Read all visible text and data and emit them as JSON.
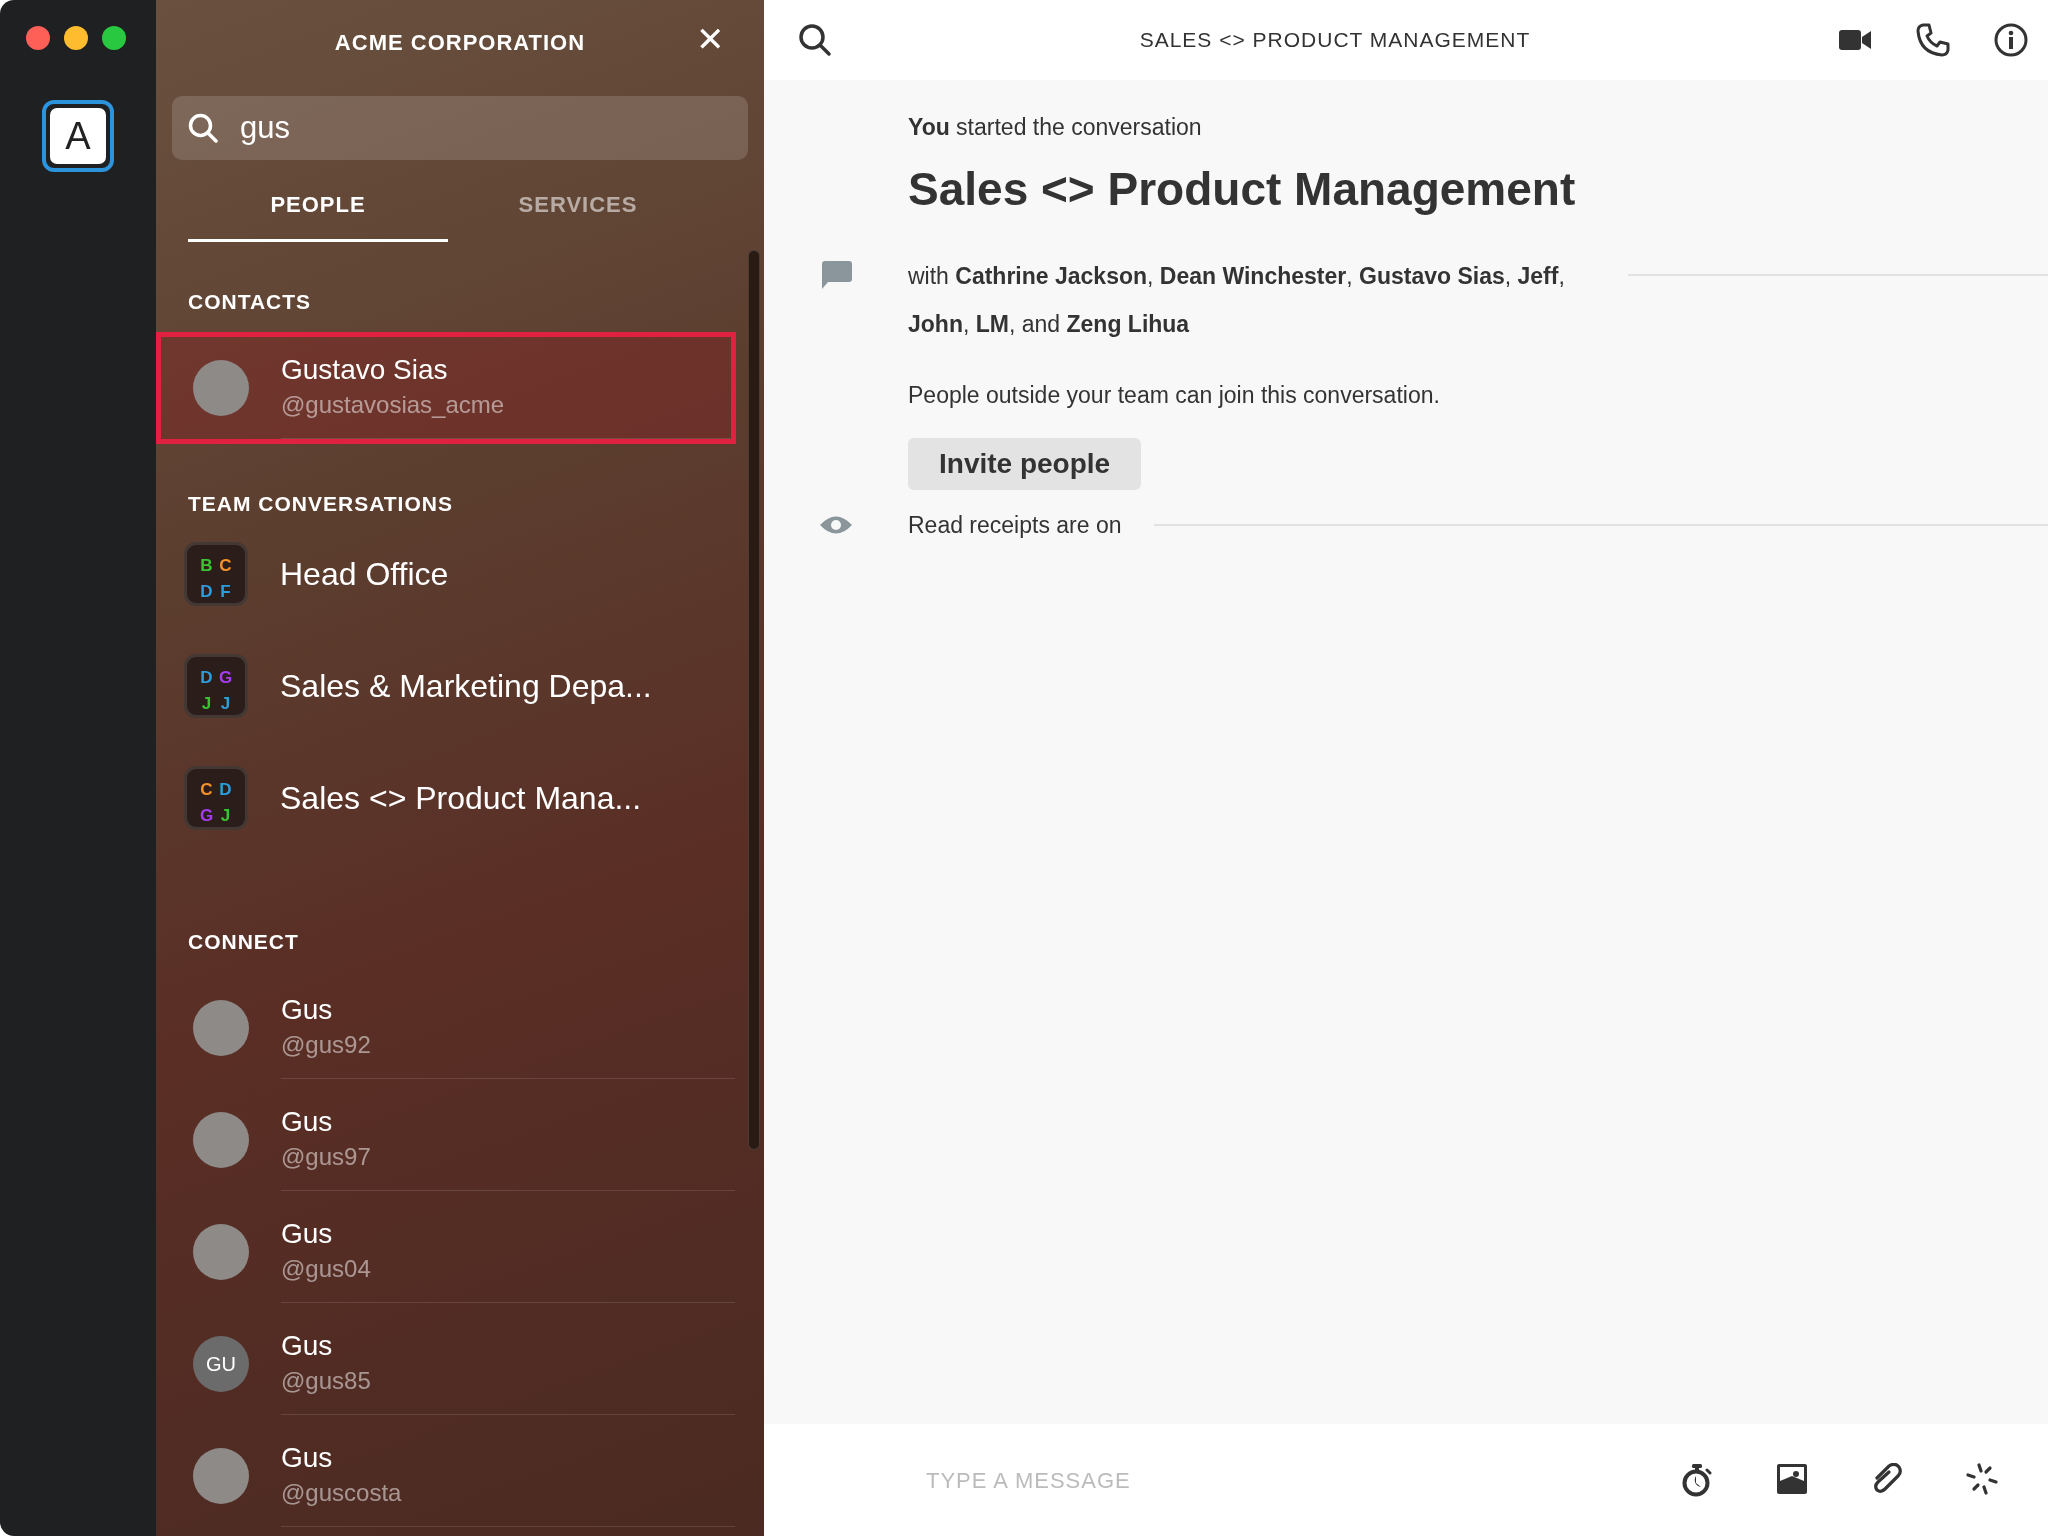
{
  "window": {
    "controls": [
      {
        "color": "#fe5f57"
      },
      {
        "color": "#febc2e"
      },
      {
        "color": "#28c840"
      }
    ]
  },
  "rail": {
    "account_letter": "A",
    "selected": true
  },
  "sidebar": {
    "title": "ACME CORPORATION",
    "close_glyph": "✕",
    "search": {
      "value": "gus"
    },
    "tabs": [
      {
        "label": "PEOPLE",
        "selected": true
      },
      {
        "label": "SERVICES",
        "selected": false
      }
    ],
    "sections": [
      {
        "heading": "CONTACTS",
        "kind": "people",
        "items": [
          {
            "name": "Gustavo Sias",
            "handle": "@gustavosias_acme",
            "kind": "photo",
            "selected": true
          }
        ]
      },
      {
        "heading": "TEAM CONVERSATIONS",
        "kind": "groups",
        "items": [
          {
            "name": "Head Office",
            "letters": [
              {
                "letter": "B",
                "color": "#38c531"
              },
              {
                "letter": "C",
                "color": "#f7922b"
              },
              {
                "letter": "D",
                "color": "#2e9ddb"
              },
              {
                "letter": "F",
                "color": "#2e9ddb"
              }
            ]
          },
          {
            "name": "Sales & Marketing Depa...",
            "letters": [
              {
                "letter": "D",
                "color": "#2e9ddb"
              },
              {
                "letter": "G",
                "color": "#a63cf0"
              },
              {
                "letter": "J",
                "color": "#38c531"
              },
              {
                "letter": "J",
                "color": "#2e9ddb"
              }
            ]
          },
          {
            "name": "Sales <> Product Mana...",
            "letters": [
              {
                "letter": "C",
                "color": "#f7922b"
              },
              {
                "letter": "D",
                "color": "#2e9ddb"
              },
              {
                "letter": "G",
                "color": "#a63cf0"
              },
              {
                "letter": "J",
                "color": "#38c531"
              }
            ]
          }
        ]
      },
      {
        "heading": "CONNECT",
        "kind": "people",
        "items": [
          {
            "name": "Gus",
            "handle": "@gus92",
            "kind": "photo",
            "selected": false
          },
          {
            "name": "Gus",
            "handle": "@gus97",
            "kind": "photo",
            "selected": false
          },
          {
            "name": "Gus",
            "handle": "@gus04",
            "kind": "photo",
            "selected": false
          },
          {
            "name": "Gus",
            "handle": "@gus85",
            "kind": "initials",
            "initials": "GU",
            "selected": false
          },
          {
            "name": "Gus",
            "handle": "@guscosta",
            "kind": "photo",
            "selected": false
          }
        ]
      }
    ]
  },
  "conversation": {
    "title": "SALES <> PRODUCT MANAGEMENT",
    "started": "**You** started the conversation",
    "heading": "Sales <> Product Management",
    "participants": "with **Cathrine Jackson**, **Dean Winchester**, **Gustavo Sias**, **Jeff**, **John**, **LM**, and **Zeng Lihua**",
    "guest_note": "People outside your team can join this conversation.",
    "invite_button": "Invite people",
    "receipts": "Read receipts are on",
    "composer": {
      "placeholder": "TYPE A MESSAGE"
    }
  }
}
